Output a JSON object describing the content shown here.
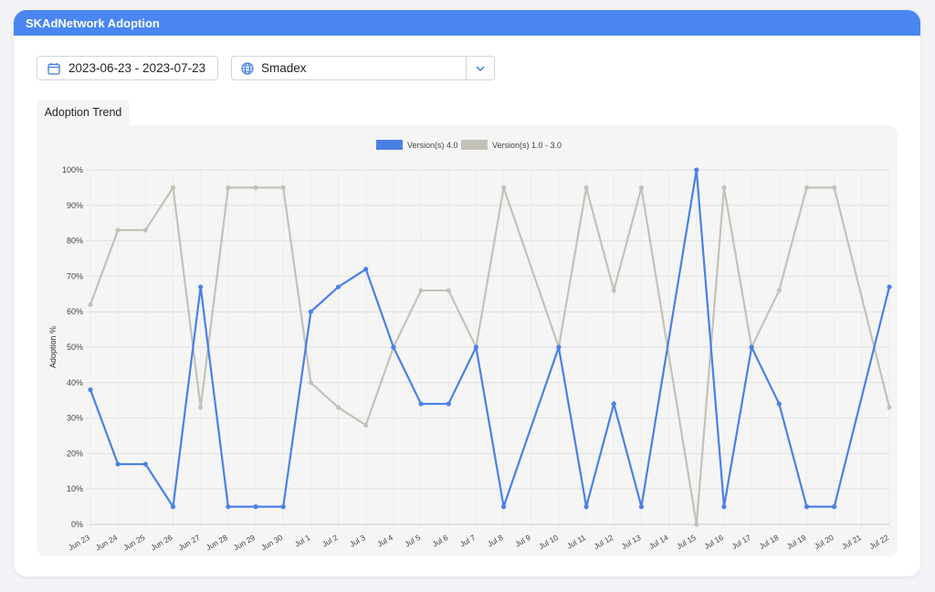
{
  "panel": {
    "title": "SKAdNetwork Adoption"
  },
  "filters": {
    "date_range": "2023-06-23 - 2023-07-23",
    "network": "Smadex"
  },
  "tabs": [
    {
      "label": "Adoption Trend",
      "active": true
    }
  ],
  "icons": {
    "date": "calendar-icon",
    "network": "globe-icon",
    "dropdown": "chevron-down-icon"
  },
  "colors": {
    "header": "#4a86f0",
    "series_v4": "#4a80e6",
    "series_v1_3": "#c4c2b8",
    "accent": "#4a86f0"
  },
  "chart_data": {
    "type": "line",
    "ylabel": "Adoption %",
    "xlabel": "",
    "ylim": [
      0,
      100
    ],
    "yticks": [
      "0%",
      "10%",
      "20%",
      "30%",
      "40%",
      "50%",
      "60%",
      "70%",
      "80%",
      "90%",
      "100%"
    ],
    "grid": true,
    "legend_position": "top-center",
    "categories": [
      "Jun 23",
      "Jun 24",
      "Jun 25",
      "Jun 26",
      "Jun 27",
      "Jun 28",
      "Jun 29",
      "Jun 30",
      "Jul 1",
      "Jul 2",
      "Jul 3",
      "Jul 4",
      "Jul 5",
      "Jul 6",
      "Jul 7",
      "Jul 8",
      "Jul 9",
      "Jul 10",
      "Jul 11",
      "Jul 12",
      "Jul 13",
      "Jul 14",
      "Jul 15",
      "Jul 16",
      "Jul 17",
      "Jul 18",
      "Jul 19",
      "Jul 20",
      "Jul 21",
      "Jul 22"
    ],
    "series": [
      {
        "name": "Version(s) 4.0",
        "color": "#4a80e6",
        "values": [
          38,
          17,
          17,
          5,
          67,
          5,
          5,
          5,
          60,
          67,
          72,
          50,
          34,
          34,
          50,
          5,
          null,
          50,
          5,
          34,
          5,
          null,
          100,
          5,
          50,
          34,
          5,
          5,
          null,
          67
        ]
      },
      {
        "name": "Version(s) 1.0 - 3.0",
        "color": "#c4c2b8",
        "values": [
          62,
          83,
          83,
          95,
          33,
          95,
          95,
          95,
          40,
          33,
          28,
          50,
          66,
          66,
          50,
          95,
          null,
          50,
          95,
          66,
          95,
          null,
          0,
          95,
          50,
          66,
          95,
          95,
          null,
          33
        ]
      }
    ]
  }
}
